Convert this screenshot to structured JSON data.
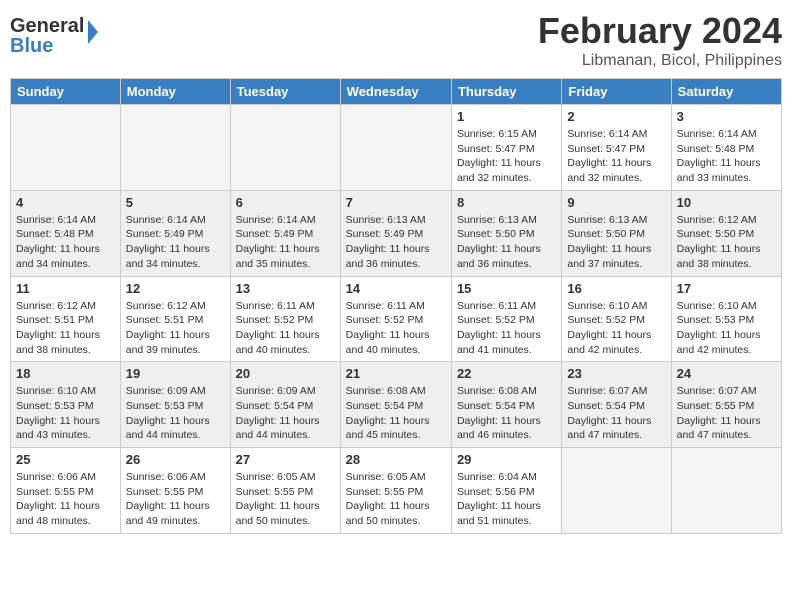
{
  "header": {
    "logo_general": "General",
    "logo_blue": "Blue",
    "month_title": "February 2024",
    "location": "Libmanan, Bicol, Philippines"
  },
  "days_of_week": [
    "Sunday",
    "Monday",
    "Tuesday",
    "Wednesday",
    "Thursday",
    "Friday",
    "Saturday"
  ],
  "weeks": [
    [
      {
        "day": "",
        "info": ""
      },
      {
        "day": "",
        "info": ""
      },
      {
        "day": "",
        "info": ""
      },
      {
        "day": "",
        "info": ""
      },
      {
        "day": "1",
        "info": "Sunrise: 6:15 AM\nSunset: 5:47 PM\nDaylight: 11 hours\nand 32 minutes."
      },
      {
        "day": "2",
        "info": "Sunrise: 6:14 AM\nSunset: 5:47 PM\nDaylight: 11 hours\nand 32 minutes."
      },
      {
        "day": "3",
        "info": "Sunrise: 6:14 AM\nSunset: 5:48 PM\nDaylight: 11 hours\nand 33 minutes."
      }
    ],
    [
      {
        "day": "4",
        "info": "Sunrise: 6:14 AM\nSunset: 5:48 PM\nDaylight: 11 hours\nand 34 minutes."
      },
      {
        "day": "5",
        "info": "Sunrise: 6:14 AM\nSunset: 5:49 PM\nDaylight: 11 hours\nand 34 minutes."
      },
      {
        "day": "6",
        "info": "Sunrise: 6:14 AM\nSunset: 5:49 PM\nDaylight: 11 hours\nand 35 minutes."
      },
      {
        "day": "7",
        "info": "Sunrise: 6:13 AM\nSunset: 5:49 PM\nDaylight: 11 hours\nand 36 minutes."
      },
      {
        "day": "8",
        "info": "Sunrise: 6:13 AM\nSunset: 5:50 PM\nDaylight: 11 hours\nand 36 minutes."
      },
      {
        "day": "9",
        "info": "Sunrise: 6:13 AM\nSunset: 5:50 PM\nDaylight: 11 hours\nand 37 minutes."
      },
      {
        "day": "10",
        "info": "Sunrise: 6:12 AM\nSunset: 5:50 PM\nDaylight: 11 hours\nand 38 minutes."
      }
    ],
    [
      {
        "day": "11",
        "info": "Sunrise: 6:12 AM\nSunset: 5:51 PM\nDaylight: 11 hours\nand 38 minutes."
      },
      {
        "day": "12",
        "info": "Sunrise: 6:12 AM\nSunset: 5:51 PM\nDaylight: 11 hours\nand 39 minutes."
      },
      {
        "day": "13",
        "info": "Sunrise: 6:11 AM\nSunset: 5:52 PM\nDaylight: 11 hours\nand 40 minutes."
      },
      {
        "day": "14",
        "info": "Sunrise: 6:11 AM\nSunset: 5:52 PM\nDaylight: 11 hours\nand 40 minutes."
      },
      {
        "day": "15",
        "info": "Sunrise: 6:11 AM\nSunset: 5:52 PM\nDaylight: 11 hours\nand 41 minutes."
      },
      {
        "day": "16",
        "info": "Sunrise: 6:10 AM\nSunset: 5:52 PM\nDaylight: 11 hours\nand 42 minutes."
      },
      {
        "day": "17",
        "info": "Sunrise: 6:10 AM\nSunset: 5:53 PM\nDaylight: 11 hours\nand 42 minutes."
      }
    ],
    [
      {
        "day": "18",
        "info": "Sunrise: 6:10 AM\nSunset: 5:53 PM\nDaylight: 11 hours\nand 43 minutes."
      },
      {
        "day": "19",
        "info": "Sunrise: 6:09 AM\nSunset: 5:53 PM\nDaylight: 11 hours\nand 44 minutes."
      },
      {
        "day": "20",
        "info": "Sunrise: 6:09 AM\nSunset: 5:54 PM\nDaylight: 11 hours\nand 44 minutes."
      },
      {
        "day": "21",
        "info": "Sunrise: 6:08 AM\nSunset: 5:54 PM\nDaylight: 11 hours\nand 45 minutes."
      },
      {
        "day": "22",
        "info": "Sunrise: 6:08 AM\nSunset: 5:54 PM\nDaylight: 11 hours\nand 46 minutes."
      },
      {
        "day": "23",
        "info": "Sunrise: 6:07 AM\nSunset: 5:54 PM\nDaylight: 11 hours\nand 47 minutes."
      },
      {
        "day": "24",
        "info": "Sunrise: 6:07 AM\nSunset: 5:55 PM\nDaylight: 11 hours\nand 47 minutes."
      }
    ],
    [
      {
        "day": "25",
        "info": "Sunrise: 6:06 AM\nSunset: 5:55 PM\nDaylight: 11 hours\nand 48 minutes."
      },
      {
        "day": "26",
        "info": "Sunrise: 6:06 AM\nSunset: 5:55 PM\nDaylight: 11 hours\nand 49 minutes."
      },
      {
        "day": "27",
        "info": "Sunrise: 6:05 AM\nSunset: 5:55 PM\nDaylight: 11 hours\nand 50 minutes."
      },
      {
        "day": "28",
        "info": "Sunrise: 6:05 AM\nSunset: 5:55 PM\nDaylight: 11 hours\nand 50 minutes."
      },
      {
        "day": "29",
        "info": "Sunrise: 6:04 AM\nSunset: 5:56 PM\nDaylight: 11 hours\nand 51 minutes."
      },
      {
        "day": "",
        "info": ""
      },
      {
        "day": "",
        "info": ""
      }
    ]
  ]
}
